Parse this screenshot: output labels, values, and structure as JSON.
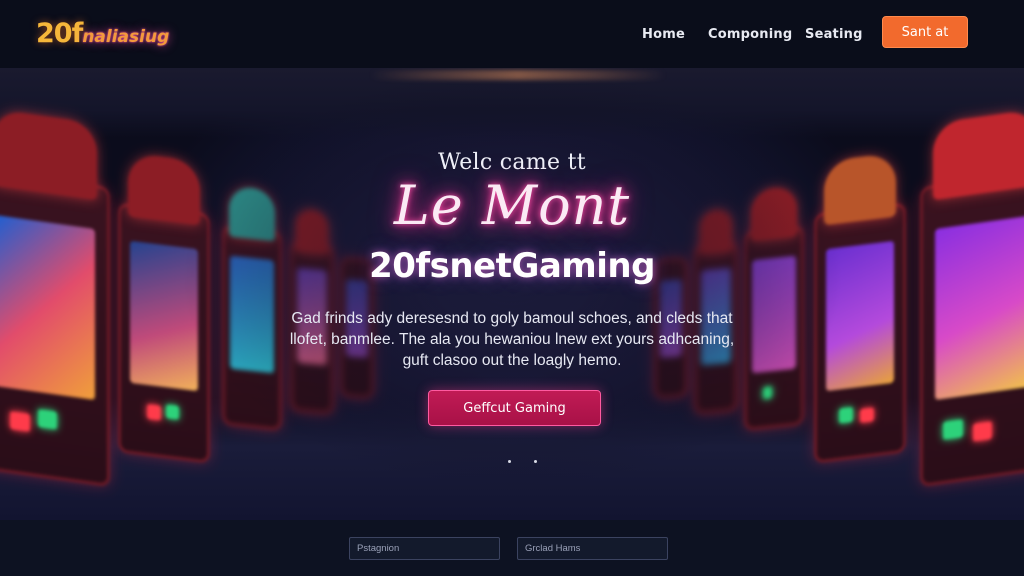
{
  "header": {
    "logo_prefix": "20f",
    "logo_rest": "naliasiug",
    "nav": [
      "Home",
      "Componing",
      "Seating"
    ],
    "cta_label": "Sant at"
  },
  "hero": {
    "welcome": "Welc came tt",
    "script_title": "Le Mont",
    "brand": "20fsnetGaming",
    "description_lines": [
      "Gad frinds ady deresesnd  to goly bamoul schoes, and cleds that",
      "llofet, banmlee. The ala you hewaniou lnew ext yours adhcaning,",
      "guft clasoo out the loagly hemo."
    ],
    "button_label": "Geffcut Gaming"
  },
  "footer": {
    "field1_placeholder": "Pstagnion",
    "field2_placeholder": "Grclad Hams"
  },
  "colors": {
    "accent_orange": "#f26a2d",
    "accent_pink": "#c11b55",
    "neon_pink": "#ff2f95",
    "header_bg": "#0a0d1a"
  }
}
